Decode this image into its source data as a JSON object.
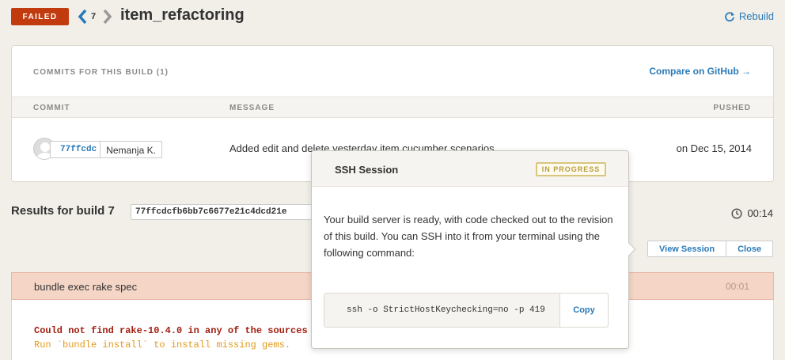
{
  "header": {
    "status": "FAILED",
    "build_number": "7",
    "branch": "item_refactoring",
    "rebuild_label": "Rebuild"
  },
  "commits_card": {
    "title": "COMMITS FOR THIS BUILD (1)",
    "compare_label": "Compare on GitHub →",
    "columns": [
      "COMMIT",
      "MESSAGE",
      "PUSHED"
    ],
    "rows": [
      {
        "sha": "77ffcdc",
        "author": "Nemanja K.",
        "message": "Added edit and delete yesterday item cucumber scenarios",
        "pushed": "on Dec 15, 2014"
      }
    ]
  },
  "results": {
    "label": "Results for build 7",
    "sha": "77ffcdcfb6bb7c6677e21c4dcd21e",
    "duration": "00:14",
    "view_session_label": "View Session",
    "close_label": "Close"
  },
  "step": {
    "name": "bundle exec rake spec",
    "time": "00:01",
    "output_error": "Could not find rake-10.4.0 in any of the sources",
    "output_hint": "Run `bundle install` to install missing gems."
  },
  "ssh_popover": {
    "title": "SSH Session",
    "status": "IN PROGRESS",
    "text": "Your build server is ready, with code checked out to the revision of this build. You can SSH into it from your terminal using the following command:",
    "command": "ssh -o StrictHostKeychecking=no -p 419",
    "copy_label": "Copy"
  },
  "colors": {
    "failed": "#c23b0f",
    "link": "#2a7ab8",
    "in_progress": "#b99d3a",
    "error_text": "#a01e10",
    "hint_text": "#e39a1a"
  }
}
